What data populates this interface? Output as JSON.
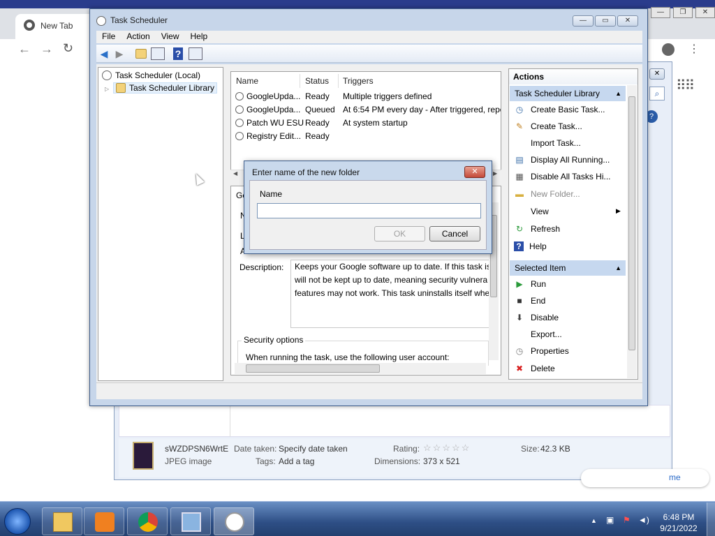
{
  "chrome": {
    "tab_title": "New Tab",
    "back_glyph": "←",
    "forward_glyph": "→",
    "reload_glyph": "↻",
    "win_minimize": "—",
    "win_restore": "❐",
    "win_close": "✕"
  },
  "viewer": {
    "filename": "sWZDPSN6WrtE",
    "filetype": "JPEG image",
    "date_taken_label": "Date taken:",
    "date_taken_value": "Specify date taken",
    "tags_label": "Tags:",
    "tags_value": "Add a tag",
    "rating_label": "Rating:",
    "stars": "☆☆☆☆☆",
    "dimensions_label": "Dimensions:",
    "dimensions_value": "373 x 521",
    "size_label": "Size:",
    "size_value": "42.3 KB",
    "partial_text": "me"
  },
  "task_scheduler": {
    "title": "Task Scheduler",
    "menu": [
      "File",
      "Action",
      "View",
      "Help"
    ],
    "tree": {
      "root": "Task Scheduler (Local)",
      "child": "Task Scheduler Library"
    },
    "columns": [
      "Name",
      "Status",
      "Triggers"
    ],
    "tasks": [
      {
        "name": "GoogleUpda...",
        "status": "Ready",
        "trigger": "Multiple triggers defined"
      },
      {
        "name": "GoogleUpda...",
        "status": "Queued",
        "trigger": "At 6:54 PM every day - After triggered, repe"
      },
      {
        "name": "Patch WU ESU",
        "status": "Ready",
        "trigger": "At system startup"
      },
      {
        "name": "Registry Edit...",
        "status": "Ready",
        "trigger": ""
      }
    ],
    "details": {
      "tab_partial": "Ge",
      "n_partial": "N",
      "l_partial": "L",
      "a_partial": "A",
      "description_label": "Description:",
      "description_lines": [
        "Keeps your Google software up to date. If this task is",
        "will not be kept up to date, meaning security vulnera",
        "features may not work. This task uninstalls itself whe"
      ],
      "security_options": "Security options",
      "run_as_text": "When running the task, use the following user account:"
    },
    "actions": {
      "title": "Actions",
      "section1": "Task Scheduler Library",
      "items1": [
        {
          "label": "Create Basic Task...",
          "icon": "create-basic-task-icon",
          "glyph": "◷",
          "color": "#3a6ea8"
        },
        {
          "label": "Create Task...",
          "icon": "create-task-icon",
          "glyph": "✎",
          "color": "#c08020"
        },
        {
          "label": "Import Task...",
          "icon": "import-task-icon",
          "glyph": "",
          "color": "#555"
        },
        {
          "label": "Display All Running...",
          "icon": "display-running-icon",
          "glyph": "▤",
          "color": "#3a6ea8"
        },
        {
          "label": "Disable All Tasks Hi...",
          "icon": "disable-history-icon",
          "glyph": "▦",
          "color": "#555"
        },
        {
          "label": "New Folder...",
          "icon": "new-folder-icon",
          "glyph": "▬",
          "color": "#d8b040",
          "disabled": true
        },
        {
          "label": "View",
          "icon": "view-icon",
          "glyph": "",
          "color": "#555",
          "submenu": true
        },
        {
          "label": "Refresh",
          "icon": "refresh-icon",
          "glyph": "↻",
          "color": "#2a9a3a"
        },
        {
          "label": "Help",
          "icon": "help-icon",
          "glyph": "?",
          "color": "#fff"
        }
      ],
      "section2": "Selected Item",
      "items2": [
        {
          "label": "Run",
          "icon": "run-icon",
          "glyph": "▶",
          "color": "#2a9a3a"
        },
        {
          "label": "End",
          "icon": "end-icon",
          "glyph": "■",
          "color": "#333"
        },
        {
          "label": "Disable",
          "icon": "disable-icon",
          "glyph": "⬇",
          "color": "#444"
        },
        {
          "label": "Export...",
          "icon": "export-icon",
          "glyph": "",
          "color": "#555"
        },
        {
          "label": "Properties",
          "icon": "properties-icon",
          "glyph": "◷",
          "color": "#777"
        },
        {
          "label": "Delete",
          "icon": "delete-icon",
          "glyph": "✖",
          "color": "#d82020"
        }
      ]
    }
  },
  "dialog": {
    "title": "Enter name of the new folder",
    "close_glyph": "✕",
    "name_label": "Name",
    "input_value": "",
    "ok_label": "OK",
    "cancel_label": "Cancel"
  },
  "taskbar": {
    "time": "6:48 PM",
    "date": "9/21/2022"
  }
}
